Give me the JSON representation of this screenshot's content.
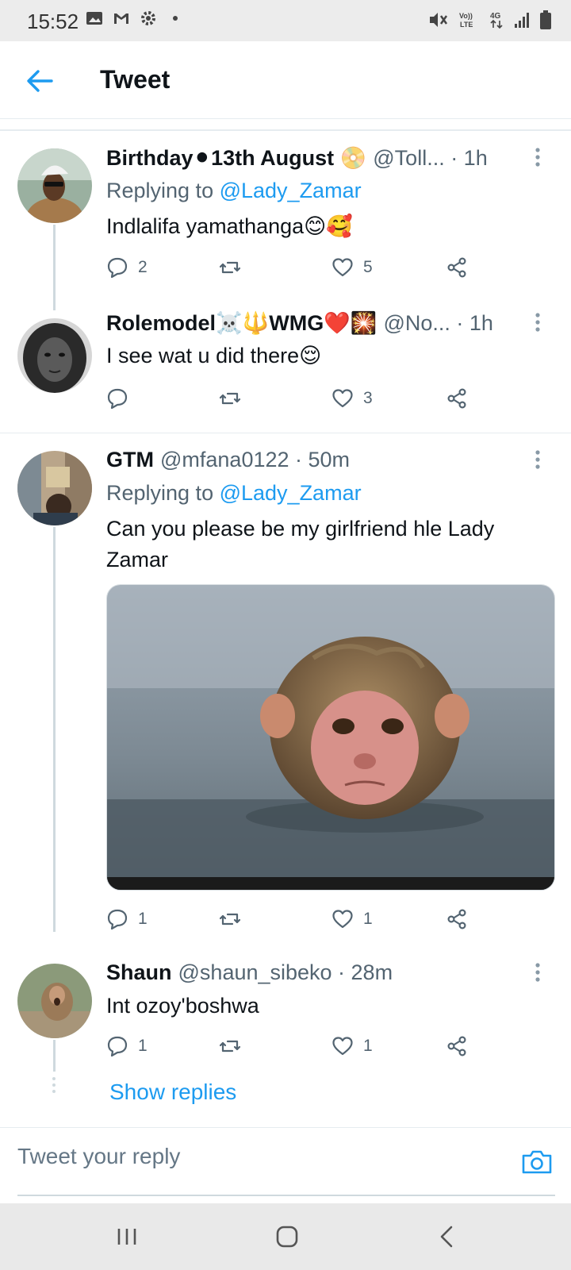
{
  "status_bar": {
    "time": "15:52"
  },
  "header": {
    "title": "Tweet"
  },
  "tweets": [
    {
      "name": "Birthday⚫13th August 📀",
      "handle_time": "@Toll... · 1h",
      "replying_prefix": "Replying to ",
      "replying_to": "@Lady_Zamar",
      "text": "Indlalifa yamathanga😊🥰",
      "replies": "2",
      "retweets": "",
      "likes": "5"
    },
    {
      "name": "Rolemodel☠️🔱WMG❤️🎇",
      "handle_time": "@No... · 1h",
      "text": "I see wat u did there😌",
      "replies": "",
      "retweets": "",
      "likes": "3"
    },
    {
      "name": "GTM",
      "handle_time": "@mfana0122 · 50m",
      "replying_prefix": "Replying to ",
      "replying_to": "@Lady_Zamar",
      "text": "Can you please be my girlfriend hle Lady Zamar",
      "replies": "1",
      "retweets": "",
      "likes": "1"
    },
    {
      "name": "Shaun",
      "handle_time": "@shaun_sibeko · 28m",
      "text": "Int ozoy'boshwa",
      "replies": "1",
      "retweets": "",
      "likes": "1"
    }
  ],
  "show_replies": "Show replies",
  "reply_bar": {
    "placeholder": "Tweet your reply"
  },
  "colors": {
    "accent": "#1d9bf0",
    "muted": "#536471",
    "thread_line": "#cfd9de"
  },
  "icons": {
    "back": "arrow-left-icon",
    "reply": "speech-bubble-icon",
    "retweet": "retweet-icon",
    "like": "heart-icon",
    "share": "share-icon",
    "camera": "camera-icon"
  }
}
